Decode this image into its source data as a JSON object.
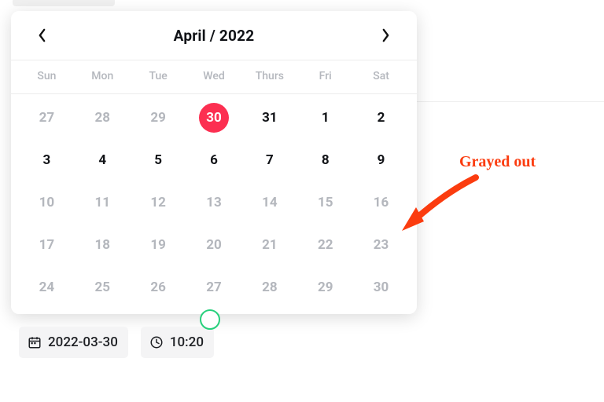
{
  "calendar": {
    "month_label": "April / 2022",
    "weekdays": [
      "Sun",
      "Mon",
      "Tue",
      "Wed",
      "Thurs",
      "Fri",
      "Sat"
    ],
    "rows": [
      [
        {
          "n": "27",
          "state": "muted"
        },
        {
          "n": "28",
          "state": "muted"
        },
        {
          "n": "29",
          "state": "muted"
        },
        {
          "n": "30",
          "state": "selected"
        },
        {
          "n": "31",
          "state": "active"
        },
        {
          "n": "1",
          "state": "active"
        },
        {
          "n": "2",
          "state": "active"
        }
      ],
      [
        {
          "n": "3",
          "state": "active"
        },
        {
          "n": "4",
          "state": "active"
        },
        {
          "n": "5",
          "state": "active"
        },
        {
          "n": "6",
          "state": "active"
        },
        {
          "n": "7",
          "state": "active"
        },
        {
          "n": "8",
          "state": "active"
        },
        {
          "n": "9",
          "state": "active"
        }
      ],
      [
        {
          "n": "10",
          "state": "muted"
        },
        {
          "n": "11",
          "state": "muted"
        },
        {
          "n": "12",
          "state": "muted"
        },
        {
          "n": "13",
          "state": "muted"
        },
        {
          "n": "14",
          "state": "muted"
        },
        {
          "n": "15",
          "state": "muted"
        },
        {
          "n": "16",
          "state": "muted"
        }
      ],
      [
        {
          "n": "17",
          "state": "muted"
        },
        {
          "n": "18",
          "state": "muted"
        },
        {
          "n": "19",
          "state": "muted"
        },
        {
          "n": "20",
          "state": "muted"
        },
        {
          "n": "21",
          "state": "muted"
        },
        {
          "n": "22",
          "state": "muted"
        },
        {
          "n": "23",
          "state": "muted"
        }
      ],
      [
        {
          "n": "24",
          "state": "muted"
        },
        {
          "n": "25",
          "state": "muted"
        },
        {
          "n": "26",
          "state": "muted"
        },
        {
          "n": "27",
          "state": "muted"
        },
        {
          "n": "28",
          "state": "muted"
        },
        {
          "n": "29",
          "state": "muted"
        },
        {
          "n": "30",
          "state": "muted"
        }
      ]
    ]
  },
  "chips": {
    "date": "2022-03-30",
    "time": "10:20"
  },
  "annotation": {
    "text": "Grayed out"
  },
  "colors": {
    "accent": "#fc2f51",
    "muted_text": "#b4b7bd",
    "annotation_red": "#fb3c0f"
  }
}
